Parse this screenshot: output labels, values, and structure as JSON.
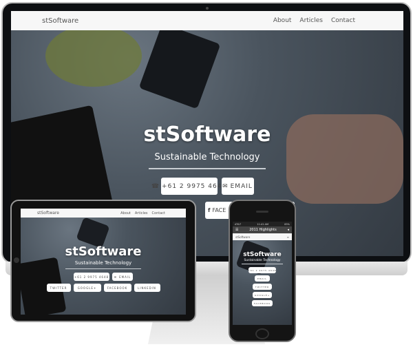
{
  "site": {
    "brand": "stSoftware",
    "nav": [
      "About",
      "Articles",
      "Contact"
    ],
    "title": "stSoftware",
    "subtitle": "Sustainable Technology",
    "phone": "+61 2 9975 4648",
    "email": "EMAIL",
    "twitter": "TWITTER",
    "google": "GOOGLE+",
    "facebook": "FACEBOOK",
    "linkedin": "LINKEDIN",
    "facebook_partial": "FACE"
  },
  "phone_device": {
    "carrier": "AT&T",
    "time": "11:41 AM",
    "battery": "83%",
    "browser_title": "2011 Highlights"
  },
  "colors": {
    "bezel": "#0d0f12",
    "nav_bg": "#f7f7f7",
    "hero": "#4a545e",
    "stand": "#d8d8d8"
  }
}
